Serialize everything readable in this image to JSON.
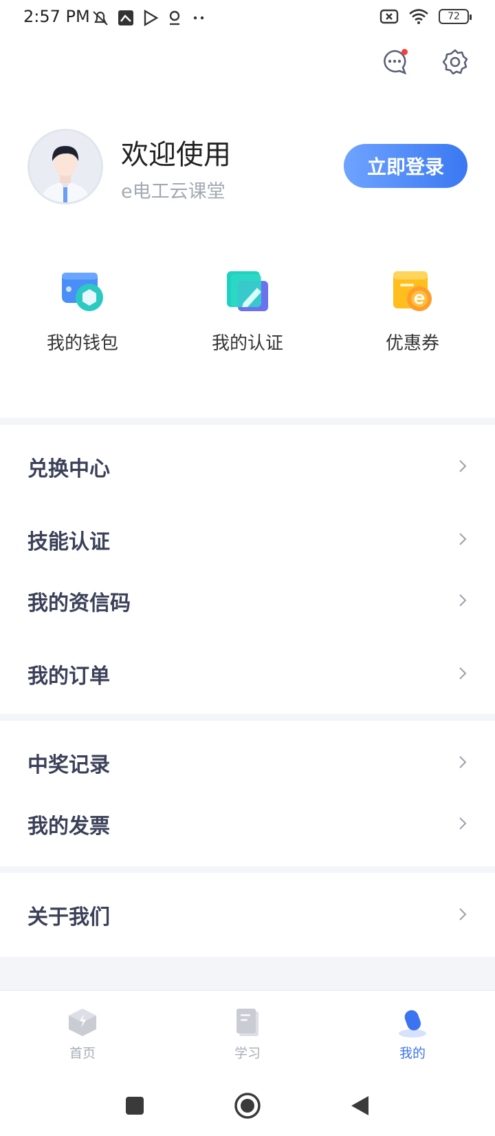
{
  "status_bar": {
    "time": "2:57 PM",
    "battery": "72"
  },
  "profile": {
    "welcome": "欢迎使用",
    "app_name": "e电工云课堂",
    "login_label": "立即登录"
  },
  "quick_actions": [
    {
      "label": "我的钱包",
      "icon": "wallet-icon"
    },
    {
      "label": "我的认证",
      "icon": "certificate-icon"
    },
    {
      "label": "优惠券",
      "icon": "coupon-icon"
    }
  ],
  "menu": {
    "group1": [
      {
        "label": "兑换中心"
      },
      {
        "label": "技能认证"
      },
      {
        "label": "我的资信码"
      },
      {
        "label": "我的订单"
      }
    ],
    "group2": [
      {
        "label": "中奖记录"
      },
      {
        "label": "我的发票"
      }
    ],
    "group3": [
      {
        "label": "关于我们"
      }
    ]
  },
  "bottom_nav": [
    {
      "label": "首页",
      "icon": "home-icon"
    },
    {
      "label": "学习",
      "icon": "book-icon"
    },
    {
      "label": "我的",
      "icon": "profile-icon",
      "active": true
    }
  ],
  "colors": {
    "accent": "#3c73f0",
    "login_gradient_start": "#6ea3ff",
    "login_gradient_end": "#3a78f2",
    "notification_dot": "#f2403a"
  }
}
